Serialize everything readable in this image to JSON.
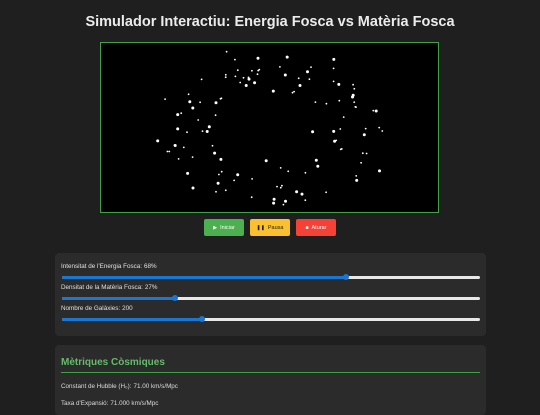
{
  "title": "Simulador Interactiu: Energia Fosca vs Matèria Fosca",
  "controls": {
    "start_icon": "play-icon",
    "start_label": "Iniciar",
    "pause_icon": "pause-icon",
    "pause_label": "Pausa",
    "stop_icon": "stop-icon",
    "stop_label": "Aturar"
  },
  "sliders": [
    {
      "label": "Intensitat de l'Energia Fosca:",
      "value": "68%",
      "fraction": 0.68
    },
    {
      "label": "Densitat de la Matèria Fosca:",
      "value": "27%",
      "fraction": 0.27
    },
    {
      "label": "Nombre de Galàxies:",
      "value": "200",
      "fraction": 0.335
    }
  ],
  "metrics": {
    "heading": "Mètriques Còsmiques",
    "hubble_label": "Constant de Hubble (H₀):",
    "hubble_value": "71.00 km/s/Mpc",
    "expansion_label": "Taxa d'Expansió:",
    "expansion_value": "71.000 km/s/Mpc"
  },
  "colors": {
    "accent_green": "#4caf50",
    "pause_yellow": "#fbc02d",
    "stop_red": "#f44336",
    "slider_blue": "#1976d2",
    "background": "#1f1f1f",
    "panel": "#2b2b2b"
  }
}
